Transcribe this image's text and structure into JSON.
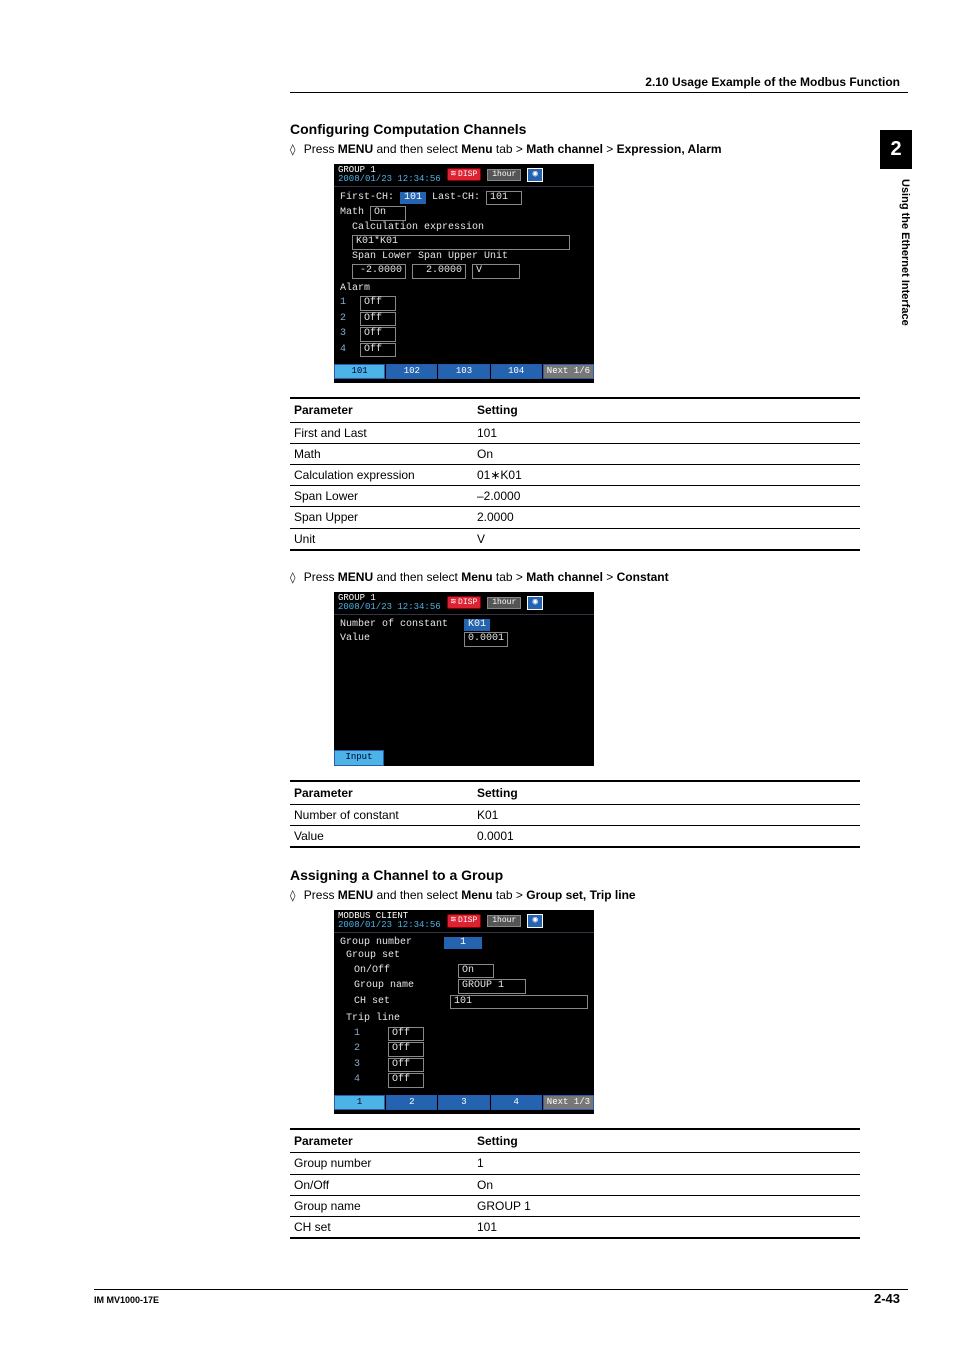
{
  "header": {
    "section_title": "2.10  Usage Example of the Modbus Function"
  },
  "side_tab": {
    "number": "2",
    "label": "Using the Ethernet Interface"
  },
  "footer": {
    "left": "IM MV1000-17E",
    "right": "2-43"
  },
  "sec_a": {
    "heading": "Configuring Computation Channels",
    "instr_prefix": "Press ",
    "instr_menu": "MENU",
    "instr_mid": " and then select ",
    "crumb1": "Menu",
    "crumb_tab": " tab > ",
    "crumb2": "Math channel",
    "crumb_gt": " > ",
    "crumb3": "Expression, Alarm"
  },
  "shot1": {
    "tb_title": "GROUP 1",
    "tb_time": "2008/01/23 12:34:56",
    "tb_disp": "DISP",
    "tb_period": "1hour",
    "first_lab": "First-CH:",
    "first_val": "101",
    "last_lab": "Last-CH:",
    "last_val": "101",
    "math_lab": "Math",
    "math_val": "On",
    "calc_lab": "Calculation expression",
    "calc_val": "K01*K01",
    "span_l_lab": "Span Lower",
    "span_l_val": "-2.0000",
    "span_u_lab": "Span Upper",
    "span_u_val": "2.0000",
    "unit_lab": "Unit",
    "unit_val": "V",
    "alarm_lab": "Alarm",
    "alarm_rows": [
      {
        "n": "1",
        "v": "Off"
      },
      {
        "n": "2",
        "v": "Off"
      },
      {
        "n": "3",
        "v": "Off"
      },
      {
        "n": "4",
        "v": "Off"
      }
    ],
    "soft": [
      "101",
      "102",
      "103",
      "104",
      "Next 1/6"
    ]
  },
  "table_a": {
    "h_param": "Parameter",
    "h_setting": "Setting",
    "rows": [
      {
        "p": "First and Last",
        "s": "101"
      },
      {
        "p": "Math",
        "s": "On"
      },
      {
        "p": "Calculation expression",
        "s": "01∗K01"
      },
      {
        "p": "Span Lower",
        "s": "–2.0000"
      },
      {
        "p": "Span Upper",
        "s": "2.0000"
      },
      {
        "p": "Unit",
        "s": "V"
      }
    ]
  },
  "sec_b": {
    "instr_prefix": "Press ",
    "instr_menu": "MENU",
    "instr_mid": " and then select ",
    "crumb1": "Menu",
    "crumb_tab": " tab > ",
    "crumb2": "Math channel",
    "crumb_gt": " > ",
    "crumb3": "Constant"
  },
  "shot2": {
    "tb_title": "GROUP 1",
    "tb_time": "2008/01/23 12:34:56",
    "tb_disp": "DISP",
    "tb_period": "1hour",
    "num_lab": "Number of constant",
    "num_val": "K01",
    "val_lab": "Value",
    "val_val": "0.0001",
    "soft": [
      "Input"
    ]
  },
  "table_b": {
    "h_param": "Parameter",
    "h_setting": "Setting",
    "rows": [
      {
        "p": "Number of constant",
        "s": "K01"
      },
      {
        "p": "Value",
        "s": "0.0001"
      }
    ]
  },
  "sec_c": {
    "heading": "Assigning a Channel to a Group",
    "instr_prefix": "Press ",
    "instr_menu": "MENU",
    "instr_mid": " and then select ",
    "crumb1": "Menu",
    "crumb_tab": " tab > ",
    "crumb2": "Group set, Trip line"
  },
  "shot3": {
    "tb_title": "MODBUS CLIENT",
    "tb_time": "2008/01/23 12:34:56",
    "tb_disp": "DISP",
    "tb_period": "1hour",
    "gn_lab": "Group number",
    "gn_val": "1",
    "gs_lab": "Group set",
    "onoff_lab": "On/Off",
    "onoff_val": "On",
    "gname_lab": "Group name",
    "gname_val": "GROUP 1",
    "chset_lab": "CH set",
    "chset_val": "101",
    "trip_lab": "Trip line",
    "trip_rows": [
      {
        "n": "1",
        "v": "Off"
      },
      {
        "n": "2",
        "v": "Off"
      },
      {
        "n": "3",
        "v": "Off"
      },
      {
        "n": "4",
        "v": "Off"
      }
    ],
    "soft": [
      "1",
      "2",
      "3",
      "4",
      "Next 1/3"
    ]
  },
  "table_c": {
    "h_param": "Parameter",
    "h_setting": "Setting",
    "rows": [
      {
        "p": "Group number",
        "s": "1"
      },
      {
        "p": "On/Off",
        "s": "On"
      },
      {
        "p": "Group name",
        "s": "GROUP 1"
      },
      {
        "p": "CH set",
        "s": "101"
      }
    ]
  }
}
